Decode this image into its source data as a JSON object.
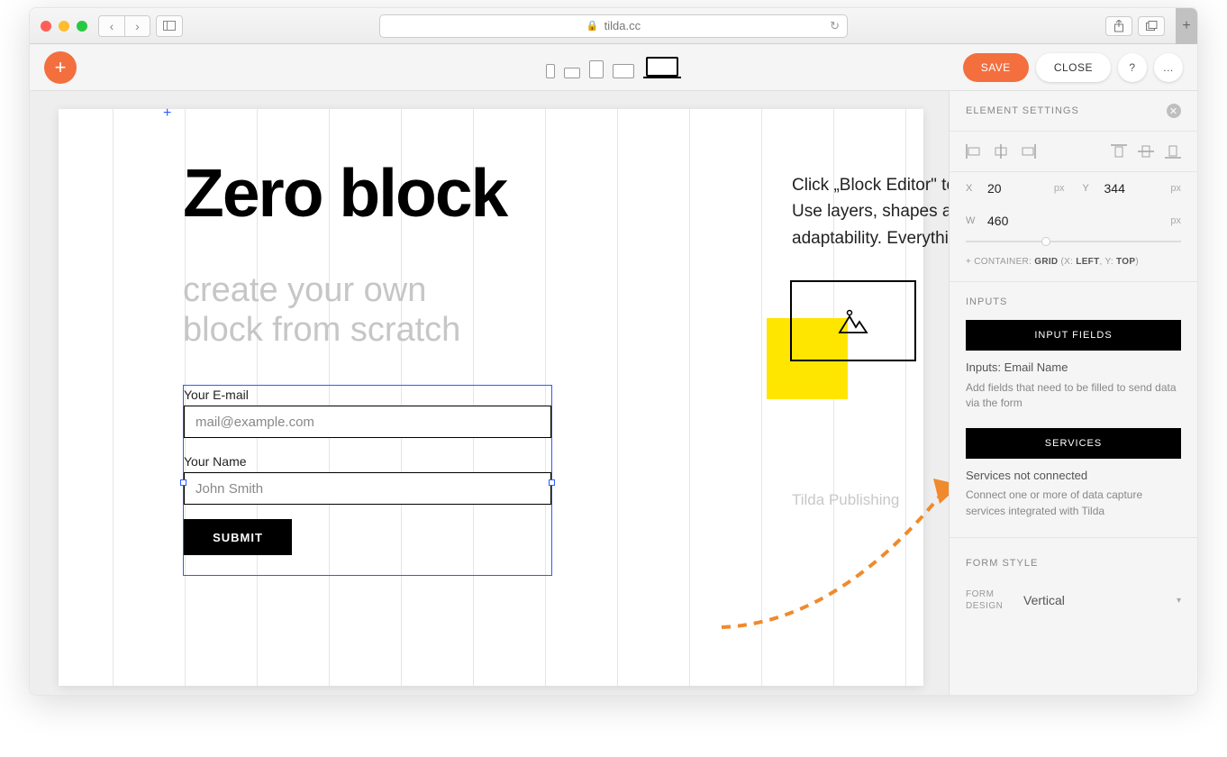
{
  "browser": {
    "url": "tilda.cc"
  },
  "toolbar": {
    "save": "SAVE",
    "close": "CLOSE",
    "help": "?",
    "more": "..."
  },
  "canvas": {
    "hero": "Zero block",
    "subtitle_l1": "create your own",
    "subtitle_l2": "block from scratch",
    "desc_l1": "Click „Block Editor\" to e",
    "desc_l2": "Use layers, shapes and",
    "desc_l3": "adaptability. Everything",
    "watermark": "Tilda Publishing",
    "form": {
      "email_label": "Your E-mail",
      "email_placeholder": "mail@example.com",
      "name_label": "Your Name",
      "name_placeholder": "John Smith",
      "submit": "SUBMIT"
    }
  },
  "panel": {
    "title": "ELEMENT SETTINGS",
    "x_label": "X",
    "x_value": "20",
    "y_label": "Y",
    "y_value": "344",
    "w_label": "W",
    "w_value": "460",
    "px": "px",
    "container_prefix": "+ CONTAINER: ",
    "container_grid": "GRID",
    "container_mid": " (X: ",
    "container_left": "LEFT",
    "container_mid2": ", Y: ",
    "container_top": "TOP",
    "container_end": ")",
    "inputs_title": "INPUTS",
    "input_fields_btn": "INPUT FIELDS",
    "inputs_list": "Inputs: Email Name",
    "inputs_help": "Add fields that need to be filled to send data via the form",
    "services_btn": "SERVICES",
    "services_status": "Services not connected",
    "services_help": "Connect one or more of data capture services integrated with Tilda",
    "form_style_title": "FORM STYLE",
    "form_design_label": "FORM\nDESIGN",
    "form_design_value": "Vertical"
  }
}
